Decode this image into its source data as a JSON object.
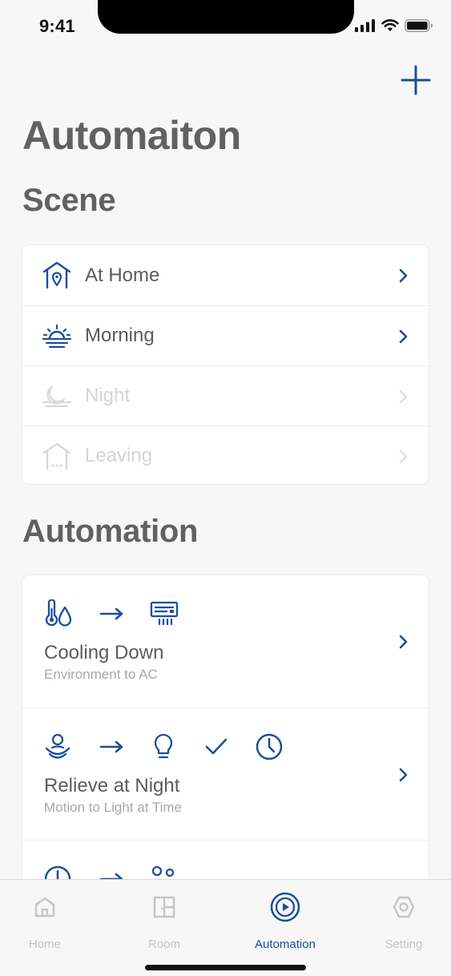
{
  "status_bar": {
    "time": "9:41"
  },
  "header": {
    "title": "Automaiton",
    "add_icon": "plus-icon"
  },
  "colors": {
    "accent": "#1a4f9c",
    "muted": "#c4c4c4",
    "text": "#5b5b5b",
    "background": "#f7f7f7"
  },
  "scene": {
    "title": "Scene",
    "items": [
      {
        "label": "At Home",
        "icon": "house-location-icon",
        "enabled": true
      },
      {
        "label": "Morning",
        "icon": "sunrise-icon",
        "enabled": true
      },
      {
        "label": "Night",
        "icon": "moon-icon",
        "enabled": false
      },
      {
        "label": "Leaving",
        "icon": "house-dots-icon",
        "enabled": false
      }
    ]
  },
  "automation": {
    "title": "Automation",
    "items": [
      {
        "name": "Cooling Down",
        "description": "Environment to AC",
        "icons": [
          "thermometer-drop-icon",
          "arrow-right-icon",
          "air-conditioner-icon"
        ]
      },
      {
        "name": "Relieve at Night",
        "description": "Motion to Light at Time",
        "icons": [
          "motion-sensor-icon",
          "arrow-right-icon",
          "lightbulb-icon",
          "checkmark-icon",
          "clock-icon"
        ]
      },
      {
        "name": "",
        "description": "",
        "icons": [
          "clock-icon",
          "arrow-right-icon",
          "people-icon"
        ]
      }
    ]
  },
  "tab_bar": {
    "tabs": [
      {
        "label": "Home",
        "icon": "home-icon",
        "active": false
      },
      {
        "label": "Room",
        "icon": "room-icon",
        "active": false
      },
      {
        "label": "Automation",
        "icon": "play-circle-icon",
        "active": true
      },
      {
        "label": "Setting",
        "icon": "hexagon-gear-icon",
        "active": false
      }
    ]
  }
}
